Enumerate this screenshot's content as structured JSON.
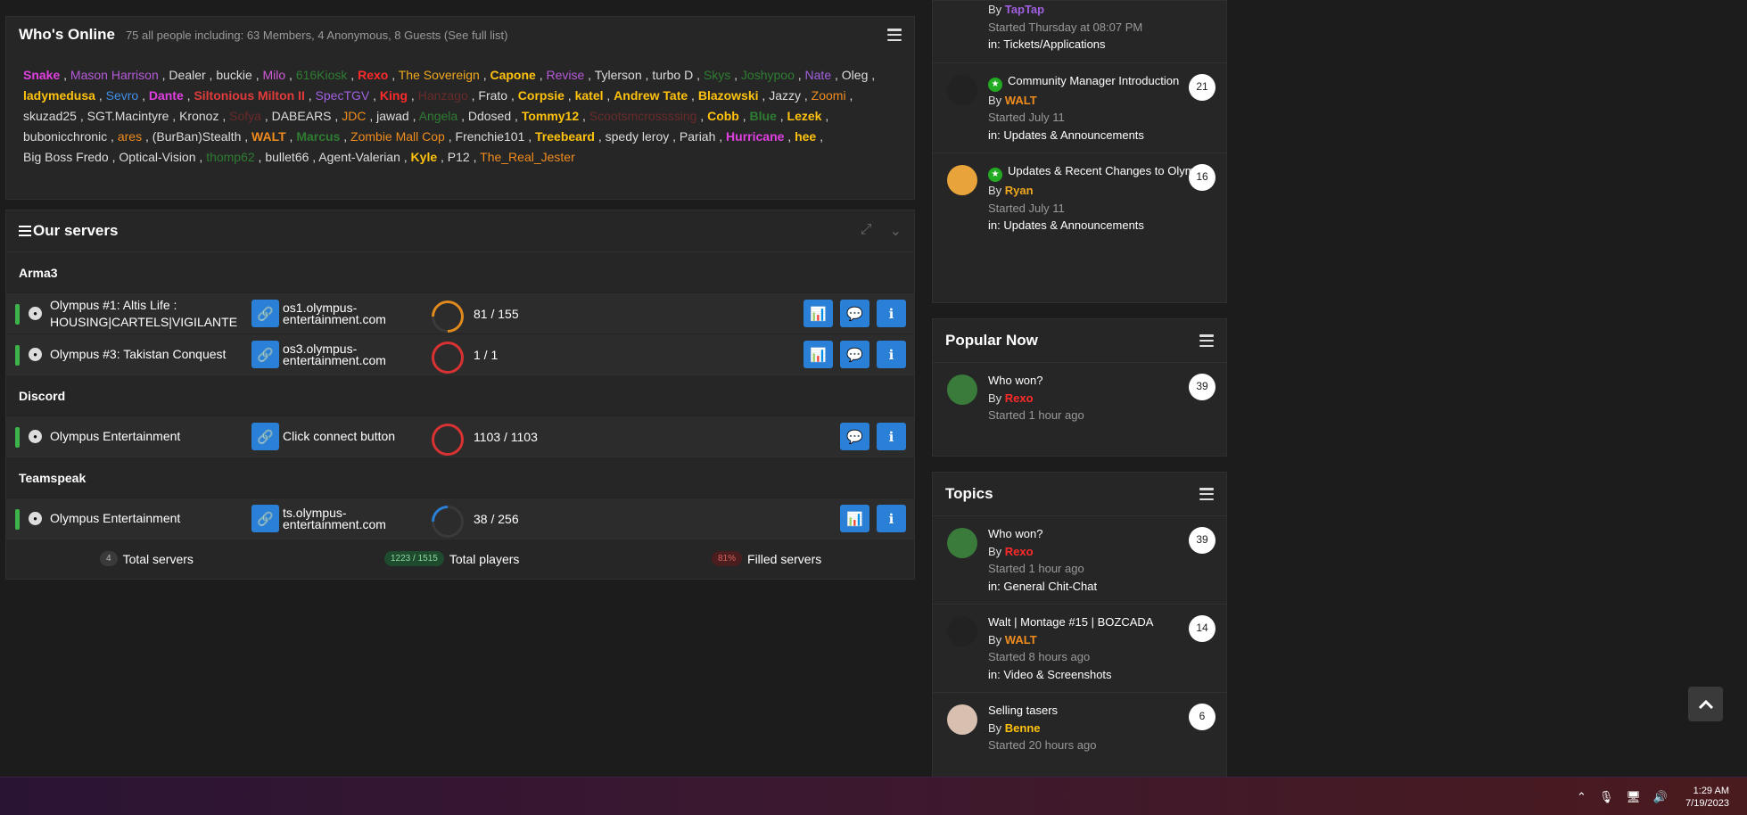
{
  "whos_online": {
    "title": "Who's Online",
    "summary": "75 all people including: 63 Members, 4 Anonymous, 8 Guests (See full list)",
    "users": [
      {
        "name": "Snake",
        "color": "#e040e0",
        "bold": true
      },
      {
        "name": "Mason Harrison",
        "color": "#b65ad8",
        "bold": false
      },
      {
        "name": "Dealer",
        "color": "#dddddd",
        "bold": false
      },
      {
        "name": "buckie",
        "color": "#dddddd",
        "bold": false
      },
      {
        "name": "Milo",
        "color": "#d25ad8",
        "bold": false
      },
      {
        "name": "616Kiosk",
        "color": "#2e7d32",
        "bold": false
      },
      {
        "name": "Rexo",
        "color": "#ff2a2a",
        "bold": true
      },
      {
        "name": "The Sovereign",
        "color": "#f0a81e",
        "bold": false
      },
      {
        "name": "Capone",
        "color": "#ffc20e",
        "bold": true
      },
      {
        "name": "Revise",
        "color": "#b65ad8",
        "bold": false
      },
      {
        "name": "Tylerson",
        "color": "#dddddd",
        "bold": false
      },
      {
        "name": "turbo D",
        "color": "#dddddd",
        "bold": false
      },
      {
        "name": "Skys",
        "color": "#2e7d32",
        "bold": false
      },
      {
        "name": "Joshypoo",
        "color": "#2e7d32",
        "bold": false
      },
      {
        "name": "Nate",
        "color": "#a060e0",
        "bold": false
      },
      {
        "name": "Oleg",
        "color": "#dddddd",
        "bold": false
      },
      {
        "name": "ladymedusa",
        "color": "#ffc20e",
        "bold": true
      },
      {
        "name": "Sevro",
        "color": "#3f8ee8",
        "bold": false
      },
      {
        "name": "Dante",
        "color": "#e040e0",
        "bold": true
      },
      {
        "name": "Siltonious Milton II",
        "color": "#e23b3b",
        "bold": true
      },
      {
        "name": "SpecTGV",
        "color": "#a060e0",
        "bold": false
      },
      {
        "name": "King",
        "color": "#ff2a2a",
        "bold": true
      },
      {
        "name": "Hanzago",
        "color": "#6a2a2a",
        "bold": false
      },
      {
        "name": "Frato",
        "color": "#dddddd",
        "bold": false
      },
      {
        "name": "Corpsie",
        "color": "#ffc20e",
        "bold": true
      },
      {
        "name": "katel",
        "color": "#ffc20e",
        "bold": true
      },
      {
        "name": "Andrew Tate",
        "color": "#ffc20e",
        "bold": true
      },
      {
        "name": "Blazowski",
        "color": "#ffc20e",
        "bold": true
      },
      {
        "name": "Jazzy",
        "color": "#dddddd",
        "bold": false
      },
      {
        "name": "Zoomi",
        "color": "#f08c1e",
        "bold": false
      },
      {
        "name": "skuzad25",
        "color": "#dddddd",
        "bold": false
      },
      {
        "name": "SGT.Macintyre",
        "color": "#dddddd",
        "bold": false
      },
      {
        "name": "Kronoz",
        "color": "#dddddd",
        "bold": false
      },
      {
        "name": "Sofya",
        "color": "#6a2a2a",
        "bold": false
      },
      {
        "name": "DABEARS",
        "color": "#dddddd",
        "bold": false
      },
      {
        "name": "JDC",
        "color": "#f08c1e",
        "bold": false
      },
      {
        "name": "jawad",
        "color": "#dddddd",
        "bold": false
      },
      {
        "name": "Angela",
        "color": "#2e7d32",
        "bold": false
      },
      {
        "name": "Ddosed",
        "color": "#dddddd",
        "bold": false
      },
      {
        "name": "Tommy12",
        "color": "#ffc20e",
        "bold": true
      },
      {
        "name": "Scootsmcrossssing",
        "color": "#6a2a2a",
        "bold": false
      },
      {
        "name": "Cobb",
        "color": "#ffc20e",
        "bold": true
      },
      {
        "name": "Blue",
        "color": "#2e7d32",
        "bold": true
      },
      {
        "name": "Lezek",
        "color": "#ffc20e",
        "bold": true
      },
      {
        "name": "bubonicchronic",
        "color": "#dddddd",
        "bold": false
      },
      {
        "name": "ares",
        "color": "#f08c1e",
        "bold": false
      },
      {
        "name": "(BurBan)Stealth",
        "color": "#dddddd",
        "bold": false
      },
      {
        "name": "WALT",
        "color": "#f08c1e",
        "bold": true
      },
      {
        "name": "Marcus",
        "color": "#2e7d32",
        "bold": true
      },
      {
        "name": "Zombie Mall Cop",
        "color": "#f08c1e",
        "bold": false
      },
      {
        "name": "Frenchie101",
        "color": "#dddddd",
        "bold": false
      },
      {
        "name": "Treebeard",
        "color": "#ffc20e",
        "bold": true
      },
      {
        "name": "spedy leroy",
        "color": "#dddddd",
        "bold": false
      },
      {
        "name": "Pariah",
        "color": "#dddddd",
        "bold": false
      },
      {
        "name": "Hurricane",
        "color": "#e040e0",
        "bold": true
      },
      {
        "name": "hee",
        "color": "#ffc20e",
        "bold": true
      },
      {
        "name": "Big Boss Fredo",
        "color": "#dddddd",
        "bold": false
      },
      {
        "name": "Optical-Vision",
        "color": "#dddddd",
        "bold": false
      },
      {
        "name": "thomp62",
        "color": "#2e7d32",
        "bold": false
      },
      {
        "name": "bullet66",
        "color": "#dddddd",
        "bold": false
      },
      {
        "name": "Agent-Valerian",
        "color": "#dddddd",
        "bold": false
      },
      {
        "name": "Kyle",
        "color": "#ffc20e",
        "bold": true
      },
      {
        "name": "P12",
        "color": "#dddddd",
        "bold": false
      },
      {
        "name": "The_Real_Jester",
        "color": "#f08c1e",
        "bold": false
      }
    ],
    "line_breaks_after": [
      15,
      29,
      43,
      55
    ]
  },
  "servers": {
    "title": "Our servers",
    "categories": [
      {
        "name": "Arma3",
        "rows": [
          {
            "name": "Olympus #1: Altis Life : HOUSING|CARTELS|VIGILANTE",
            "addr": "os1.olympus-entertainment.com",
            "count": "81 / 155",
            "fill": 0.52,
            "gauge_color": "#e08a1e",
            "actions": [
              "stats",
              "chat",
              "info"
            ]
          },
          {
            "name": "Olympus #3: Takistan Conquest",
            "addr": "os3.olympus-entertainment.com",
            "count": "1 / 1",
            "fill": 1.0,
            "gauge_color": "#d83232",
            "actions": [
              "stats",
              "chat",
              "info"
            ]
          }
        ]
      },
      {
        "name": "Discord",
        "rows": [
          {
            "name": "Olympus Entertainment",
            "addr": "Click connect button",
            "count": "1103 / 1103",
            "fill": 1.0,
            "gauge_color": "#d83232",
            "actions": [
              "chat",
              "info"
            ]
          }
        ]
      },
      {
        "name": "Teamspeak",
        "rows": [
          {
            "name": "Olympus Entertainment",
            "addr": "ts.olympus-entertainment.com",
            "count": "38 / 256",
            "fill": 0.15,
            "gauge_color": "#2a7fd6",
            "actions": [
              "stats",
              "info"
            ]
          }
        ]
      }
    ],
    "totals": {
      "servers_count": "4",
      "servers_label": "Total servers",
      "players_count": "1223 / 1515",
      "players_label": "Total players",
      "filled_count": "81%",
      "filled_label": "Filled servers"
    }
  },
  "side_top": {
    "topics": [
      {
        "partial": true,
        "by_label": "By",
        "by": "TapTap",
        "by_color": "#a060e0",
        "started": "Started Thursday at 08:07 PM",
        "in_label": "in:",
        "forum": "Tickets/Applications"
      },
      {
        "title": "Community Manager Introduction",
        "pinned": true,
        "by_label": "By",
        "by": "WALT",
        "by_color": "#f08c1e",
        "started": "Started July 11",
        "in_label": "in:",
        "forum": "Updates & Announcements",
        "count": "21"
      },
      {
        "title": "Updates & Recent Changes to Olympus",
        "pinned": true,
        "by_label": "By",
        "by": "Ryan",
        "by_color": "#f0a81e",
        "started": "Started July 11",
        "in_label": "in:",
        "forum": "Updates & Announcements",
        "count": "16"
      }
    ]
  },
  "popular": {
    "title": "Popular Now",
    "topics": [
      {
        "title": "Who won?",
        "by_label": "By",
        "by": "Rexo",
        "by_color": "#ff2a2a",
        "started": "Started 1 hour ago",
        "count": "39"
      }
    ]
  },
  "topics": {
    "title": "Topics",
    "topics": [
      {
        "title": "Who won?",
        "by_label": "By",
        "by": "Rexo",
        "by_color": "#ff2a2a",
        "started": "Started 1 hour ago",
        "in_label": "in:",
        "forum": "General Chit-Chat",
        "count": "39"
      },
      {
        "title": "Walt | Montage #15 | BOZCADA",
        "by_label": "By",
        "by": "WALT",
        "by_color": "#f08c1e",
        "started": "Started 8 hours ago",
        "in_label": "in:",
        "forum": "Video & Screenshots",
        "count": "14"
      },
      {
        "title": "Selling tasers",
        "by_label": "By",
        "by": "Benne",
        "by_color": "#ffc20e",
        "started": "Started 20 hours ago",
        "count": "6"
      }
    ]
  },
  "taskbar": {
    "time": "1:29 AM",
    "date": "7/19/2023"
  }
}
